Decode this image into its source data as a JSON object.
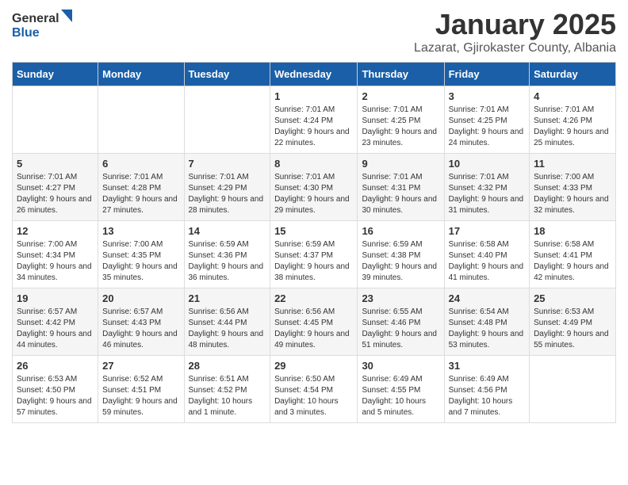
{
  "header": {
    "logo_general": "General",
    "logo_blue": "Blue",
    "title": "January 2025",
    "location": "Lazarat, Gjirokaster County, Albania"
  },
  "weekdays": [
    "Sunday",
    "Monday",
    "Tuesday",
    "Wednesday",
    "Thursday",
    "Friday",
    "Saturday"
  ],
  "weeks": [
    [
      {
        "day": "",
        "content": ""
      },
      {
        "day": "",
        "content": ""
      },
      {
        "day": "",
        "content": ""
      },
      {
        "day": "1",
        "content": "Sunrise: 7:01 AM\nSunset: 4:24 PM\nDaylight: 9 hours and 22 minutes."
      },
      {
        "day": "2",
        "content": "Sunrise: 7:01 AM\nSunset: 4:25 PM\nDaylight: 9 hours and 23 minutes."
      },
      {
        "day": "3",
        "content": "Sunrise: 7:01 AM\nSunset: 4:25 PM\nDaylight: 9 hours and 24 minutes."
      },
      {
        "day": "4",
        "content": "Sunrise: 7:01 AM\nSunset: 4:26 PM\nDaylight: 9 hours and 25 minutes."
      }
    ],
    [
      {
        "day": "5",
        "content": "Sunrise: 7:01 AM\nSunset: 4:27 PM\nDaylight: 9 hours and 26 minutes."
      },
      {
        "day": "6",
        "content": "Sunrise: 7:01 AM\nSunset: 4:28 PM\nDaylight: 9 hours and 27 minutes."
      },
      {
        "day": "7",
        "content": "Sunrise: 7:01 AM\nSunset: 4:29 PM\nDaylight: 9 hours and 28 minutes."
      },
      {
        "day": "8",
        "content": "Sunrise: 7:01 AM\nSunset: 4:30 PM\nDaylight: 9 hours and 29 minutes."
      },
      {
        "day": "9",
        "content": "Sunrise: 7:01 AM\nSunset: 4:31 PM\nDaylight: 9 hours and 30 minutes."
      },
      {
        "day": "10",
        "content": "Sunrise: 7:01 AM\nSunset: 4:32 PM\nDaylight: 9 hours and 31 minutes."
      },
      {
        "day": "11",
        "content": "Sunrise: 7:00 AM\nSunset: 4:33 PM\nDaylight: 9 hours and 32 minutes."
      }
    ],
    [
      {
        "day": "12",
        "content": "Sunrise: 7:00 AM\nSunset: 4:34 PM\nDaylight: 9 hours and 34 minutes."
      },
      {
        "day": "13",
        "content": "Sunrise: 7:00 AM\nSunset: 4:35 PM\nDaylight: 9 hours and 35 minutes."
      },
      {
        "day": "14",
        "content": "Sunrise: 6:59 AM\nSunset: 4:36 PM\nDaylight: 9 hours and 36 minutes."
      },
      {
        "day": "15",
        "content": "Sunrise: 6:59 AM\nSunset: 4:37 PM\nDaylight: 9 hours and 38 minutes."
      },
      {
        "day": "16",
        "content": "Sunrise: 6:59 AM\nSunset: 4:38 PM\nDaylight: 9 hours and 39 minutes."
      },
      {
        "day": "17",
        "content": "Sunrise: 6:58 AM\nSunset: 4:40 PM\nDaylight: 9 hours and 41 minutes."
      },
      {
        "day": "18",
        "content": "Sunrise: 6:58 AM\nSunset: 4:41 PM\nDaylight: 9 hours and 42 minutes."
      }
    ],
    [
      {
        "day": "19",
        "content": "Sunrise: 6:57 AM\nSunset: 4:42 PM\nDaylight: 9 hours and 44 minutes."
      },
      {
        "day": "20",
        "content": "Sunrise: 6:57 AM\nSunset: 4:43 PM\nDaylight: 9 hours and 46 minutes."
      },
      {
        "day": "21",
        "content": "Sunrise: 6:56 AM\nSunset: 4:44 PM\nDaylight: 9 hours and 48 minutes."
      },
      {
        "day": "22",
        "content": "Sunrise: 6:56 AM\nSunset: 4:45 PM\nDaylight: 9 hours and 49 minutes."
      },
      {
        "day": "23",
        "content": "Sunrise: 6:55 AM\nSunset: 4:46 PM\nDaylight: 9 hours and 51 minutes."
      },
      {
        "day": "24",
        "content": "Sunrise: 6:54 AM\nSunset: 4:48 PM\nDaylight: 9 hours and 53 minutes."
      },
      {
        "day": "25",
        "content": "Sunrise: 6:53 AM\nSunset: 4:49 PM\nDaylight: 9 hours and 55 minutes."
      }
    ],
    [
      {
        "day": "26",
        "content": "Sunrise: 6:53 AM\nSunset: 4:50 PM\nDaylight: 9 hours and 57 minutes."
      },
      {
        "day": "27",
        "content": "Sunrise: 6:52 AM\nSunset: 4:51 PM\nDaylight: 9 hours and 59 minutes."
      },
      {
        "day": "28",
        "content": "Sunrise: 6:51 AM\nSunset: 4:52 PM\nDaylight: 10 hours and 1 minute."
      },
      {
        "day": "29",
        "content": "Sunrise: 6:50 AM\nSunset: 4:54 PM\nDaylight: 10 hours and 3 minutes."
      },
      {
        "day": "30",
        "content": "Sunrise: 6:49 AM\nSunset: 4:55 PM\nDaylight: 10 hours and 5 minutes."
      },
      {
        "day": "31",
        "content": "Sunrise: 6:49 AM\nSunset: 4:56 PM\nDaylight: 10 hours and 7 minutes."
      },
      {
        "day": "",
        "content": ""
      }
    ]
  ]
}
